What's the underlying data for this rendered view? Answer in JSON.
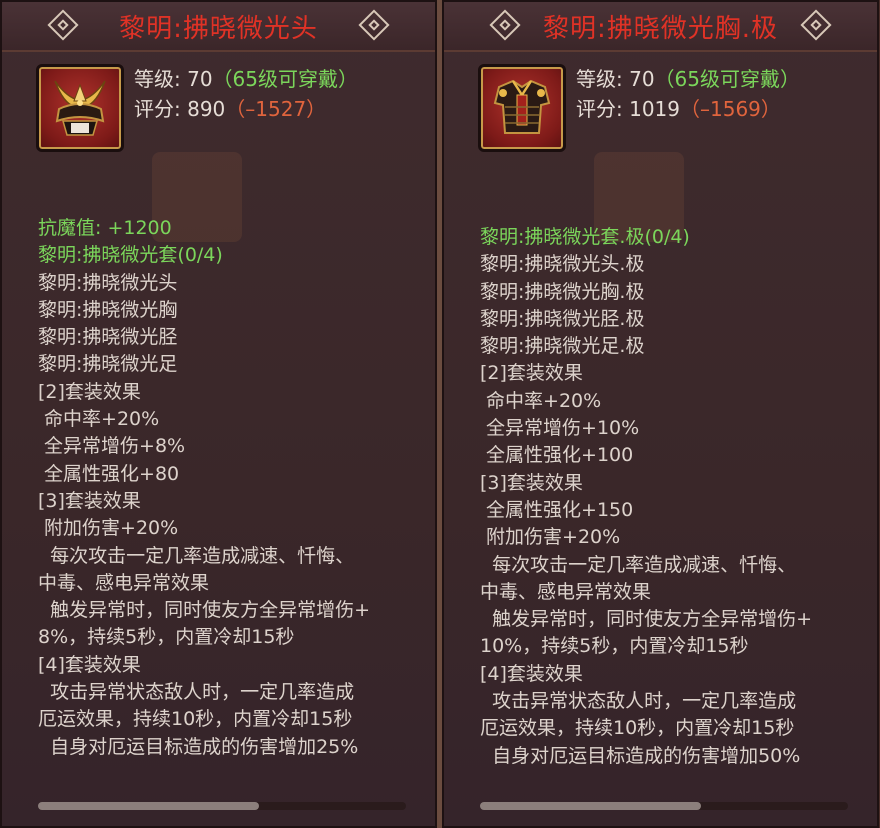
{
  "left": {
    "title": "黎明:拂晓微光头",
    "level_label": "等级: 70",
    "level_req": "（65级可穿戴）",
    "score_label": "评分: 890",
    "score_diff": "（–1527）",
    "icon": "samurai-helmet-icon",
    "lines": [
      {
        "text": "抗魔值: +1200",
        "style": "g"
      },
      {
        "text": "黎明:拂晓微光套(0/4)",
        "style": "g"
      },
      {
        "text": "黎明:拂晓微光头",
        "style": ""
      },
      {
        "text": "黎明:拂晓微光胸",
        "style": ""
      },
      {
        "text": "黎明:拂晓微光胫",
        "style": ""
      },
      {
        "text": "黎明:拂晓微光足",
        "style": ""
      },
      {
        "text": "[2]套装效果",
        "style": ""
      },
      {
        "text": " 命中率+20%",
        "style": ""
      },
      {
        "text": " 全异常增伤+8%",
        "style": ""
      },
      {
        "text": " 全属性强化+80",
        "style": ""
      },
      {
        "text": "[3]套装效果",
        "style": ""
      },
      {
        "text": " 附加伤害+20%",
        "style": ""
      },
      {
        "text": "  每次攻击一定几率造成减速、忏悔、",
        "style": ""
      },
      {
        "text": "中毒、感电异常效果",
        "style": ""
      },
      {
        "text": "  触发异常时，同时使友方全异常增伤+",
        "style": ""
      },
      {
        "text": "8%，持续5秒，内置冷却15秒",
        "style": ""
      },
      {
        "text": "[4]套装效果",
        "style": ""
      },
      {
        "text": "  攻击异常状态敌人时，一定几率造成",
        "style": ""
      },
      {
        "text": "厄运效果，持续10秒，内置冷却15秒",
        "style": ""
      },
      {
        "text": "  自身对厄运目标造成的伤害增加25%",
        "style": ""
      }
    ]
  },
  "right": {
    "title": "黎明:拂晓微光胸.极",
    "level_label": "等级: 70",
    "level_req": "（65级可穿戴）",
    "score_label": "评分: 1019",
    "score_diff": "（–1569）",
    "icon": "chest-armor-icon",
    "lines": [
      {
        "text": "黎明:拂晓微光套.极(0/4)",
        "style": "g"
      },
      {
        "text": "黎明:拂晓微光头.极",
        "style": ""
      },
      {
        "text": "黎明:拂晓微光胸.极",
        "style": ""
      },
      {
        "text": "黎明:拂晓微光胫.极",
        "style": ""
      },
      {
        "text": "黎明:拂晓微光足.极",
        "style": ""
      },
      {
        "text": "[2]套装效果",
        "style": ""
      },
      {
        "text": " 命中率+20%",
        "style": ""
      },
      {
        "text": " 全异常增伤+10%",
        "style": ""
      },
      {
        "text": " 全属性强化+100",
        "style": ""
      },
      {
        "text": "[3]套装效果",
        "style": ""
      },
      {
        "text": " 全属性强化+150",
        "style": ""
      },
      {
        "text": " 附加伤害+20%",
        "style": ""
      },
      {
        "text": "  每次攻击一定几率造成减速、忏悔、",
        "style": ""
      },
      {
        "text": "中毒、感电异常效果",
        "style": ""
      },
      {
        "text": "  触发异常时，同时使友方全异常增伤+",
        "style": ""
      },
      {
        "text": "10%，持续5秒，内置冷却15秒",
        "style": ""
      },
      {
        "text": "[4]套装效果",
        "style": ""
      },
      {
        "text": "  攻击异常状态敌人时，一定几率造成",
        "style": ""
      },
      {
        "text": "厄运效果，持续10秒，内置冷却15秒",
        "style": ""
      },
      {
        "text": "  自身对厄运目标造成的伤害增加50%",
        "style": ""
      }
    ]
  },
  "colors": {
    "title_red": "#e03226",
    "set_green": "#7bd65b",
    "diff_red": "#e0643d",
    "text_light": "#ddd3cc"
  }
}
